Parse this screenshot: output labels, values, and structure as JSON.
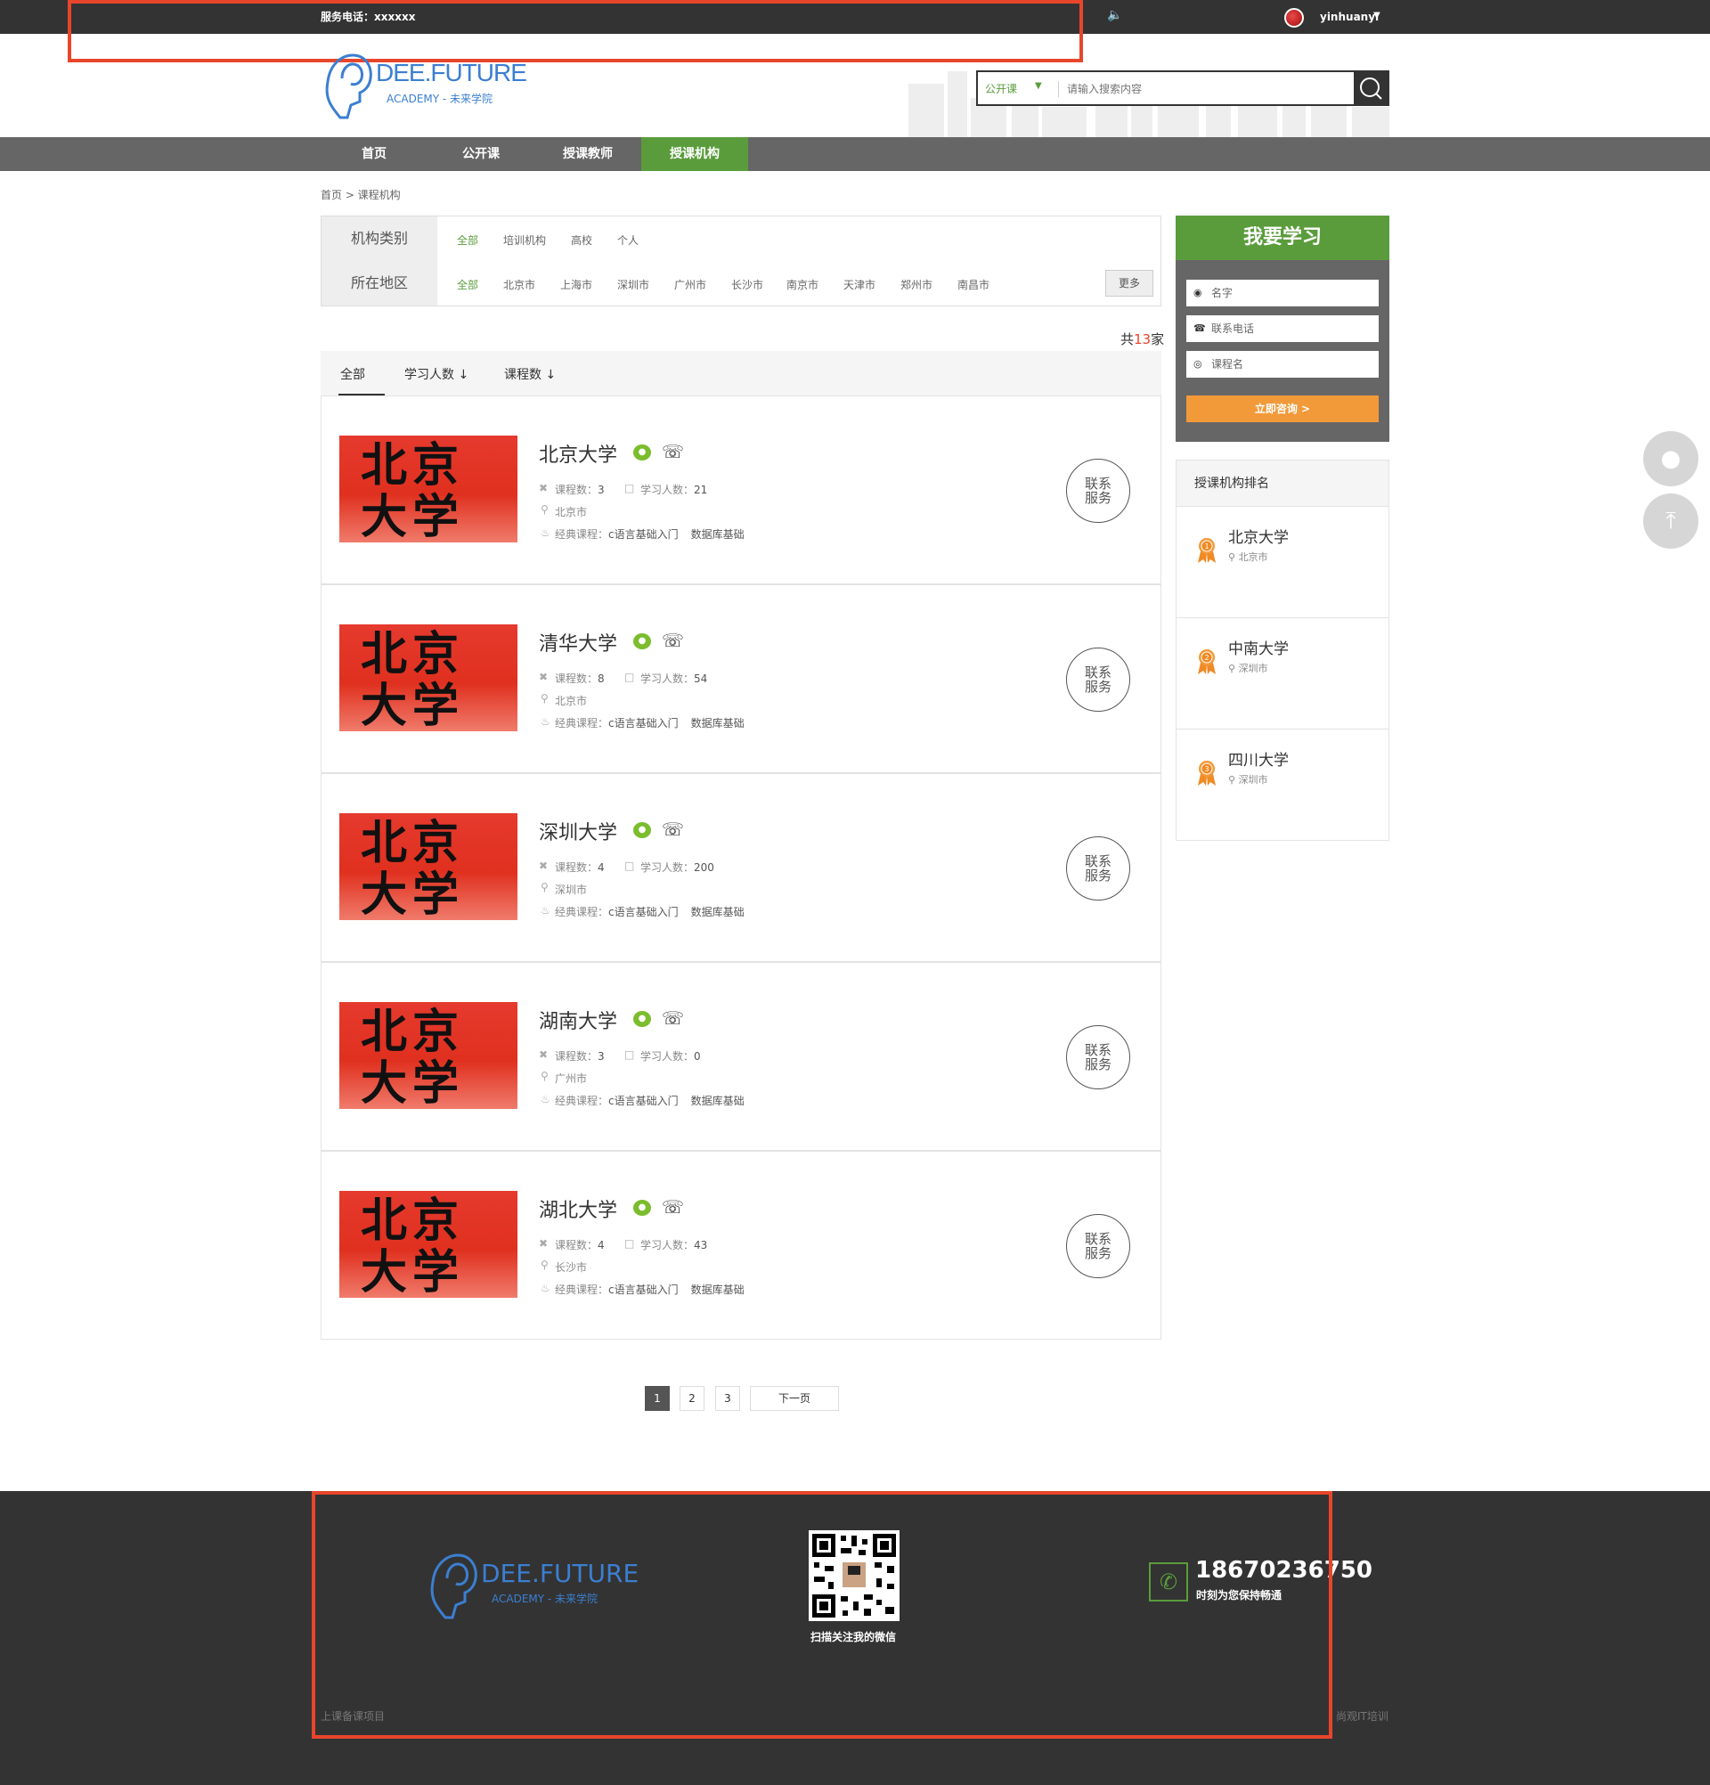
{
  "topbar": {
    "service_phone": "服务电话：xxxxxx",
    "username": "yinhuanyi"
  },
  "logo": {
    "brand": "DEE.FUTURE",
    "sub": "ACADEMY - 未来学院"
  },
  "search": {
    "category": "公开课",
    "placeholder": "请输入搜索内容"
  },
  "nav": {
    "items": [
      "首页",
      "公开课",
      "授课教师",
      "授课机构"
    ],
    "active": "授课机构"
  },
  "breadcrumb": "首页 > 课程机构",
  "filter": {
    "type_label": "机构类别",
    "type_options": [
      "全部",
      "培训机构",
      "高校",
      "个人"
    ],
    "region_label": "所在地区",
    "region_options": [
      "全部",
      "北京市",
      "上海市",
      "深圳市",
      "广州市",
      "长沙市",
      "南京市",
      "天津市",
      "郑州市",
      "南昌市"
    ],
    "more": "更多"
  },
  "total": {
    "prefix": "共",
    "count": "13",
    "suffix": "家"
  },
  "sort": {
    "all": "全部",
    "students": "学习人数 ↓",
    "courses": "课程数 ↓"
  },
  "org_list": [
    {
      "name": "北京大学",
      "courses": "3",
      "students": "21",
      "city": "北京市"
    },
    {
      "name": "清华大学",
      "courses": "8",
      "students": "54",
      "city": "北京市"
    },
    {
      "name": "深圳大学",
      "courses": "4",
      "students": "200",
      "city": "深圳市"
    },
    {
      "name": "湖南大学",
      "courses": "3",
      "students": "0",
      "city": "广州市"
    },
    {
      "name": "湖北大学",
      "courses": "4",
      "students": "43",
      "city": "长沙市"
    }
  ],
  "org_common": {
    "thumb_line1": "北京",
    "thumb_line2": "大学",
    "courses_label": "课程数：",
    "students_label": "学习人数：",
    "classic_label": "经典课程：",
    "classic_course1": "c语言基础入门",
    "classic_course2": "数据库基础",
    "contact_line1": "联系",
    "contact_line2": "服务"
  },
  "pagination": {
    "pages": [
      "1",
      "2",
      "3"
    ],
    "current": "1",
    "next": "下一页"
  },
  "learn_form": {
    "title": "我要学习",
    "name_placeholder": "名字",
    "phone_placeholder": "联系电话",
    "course_placeholder": "课程名",
    "submit": "立即咨询 >"
  },
  "ranking": {
    "title": "授课机构排名",
    "items": [
      {
        "rank": "1",
        "name": "北京大学",
        "city": "北京市"
      },
      {
        "rank": "2",
        "name": "中南大学",
        "city": "深圳市"
      },
      {
        "rank": "3",
        "name": "四川大学",
        "city": "深圳市"
      }
    ]
  },
  "footer": {
    "qr_caption": "扫描关注我的微信",
    "phone": "18670236750",
    "phone_caption": "时刻为您保持畅通",
    "left_text": "上课备课项目",
    "right_text": "尚观IT培训"
  },
  "colors": {
    "accent_green": "#5a9c3c",
    "highlight_red": "#e8462b",
    "cta_orange": "#f29a3a",
    "dark": "#333333"
  }
}
